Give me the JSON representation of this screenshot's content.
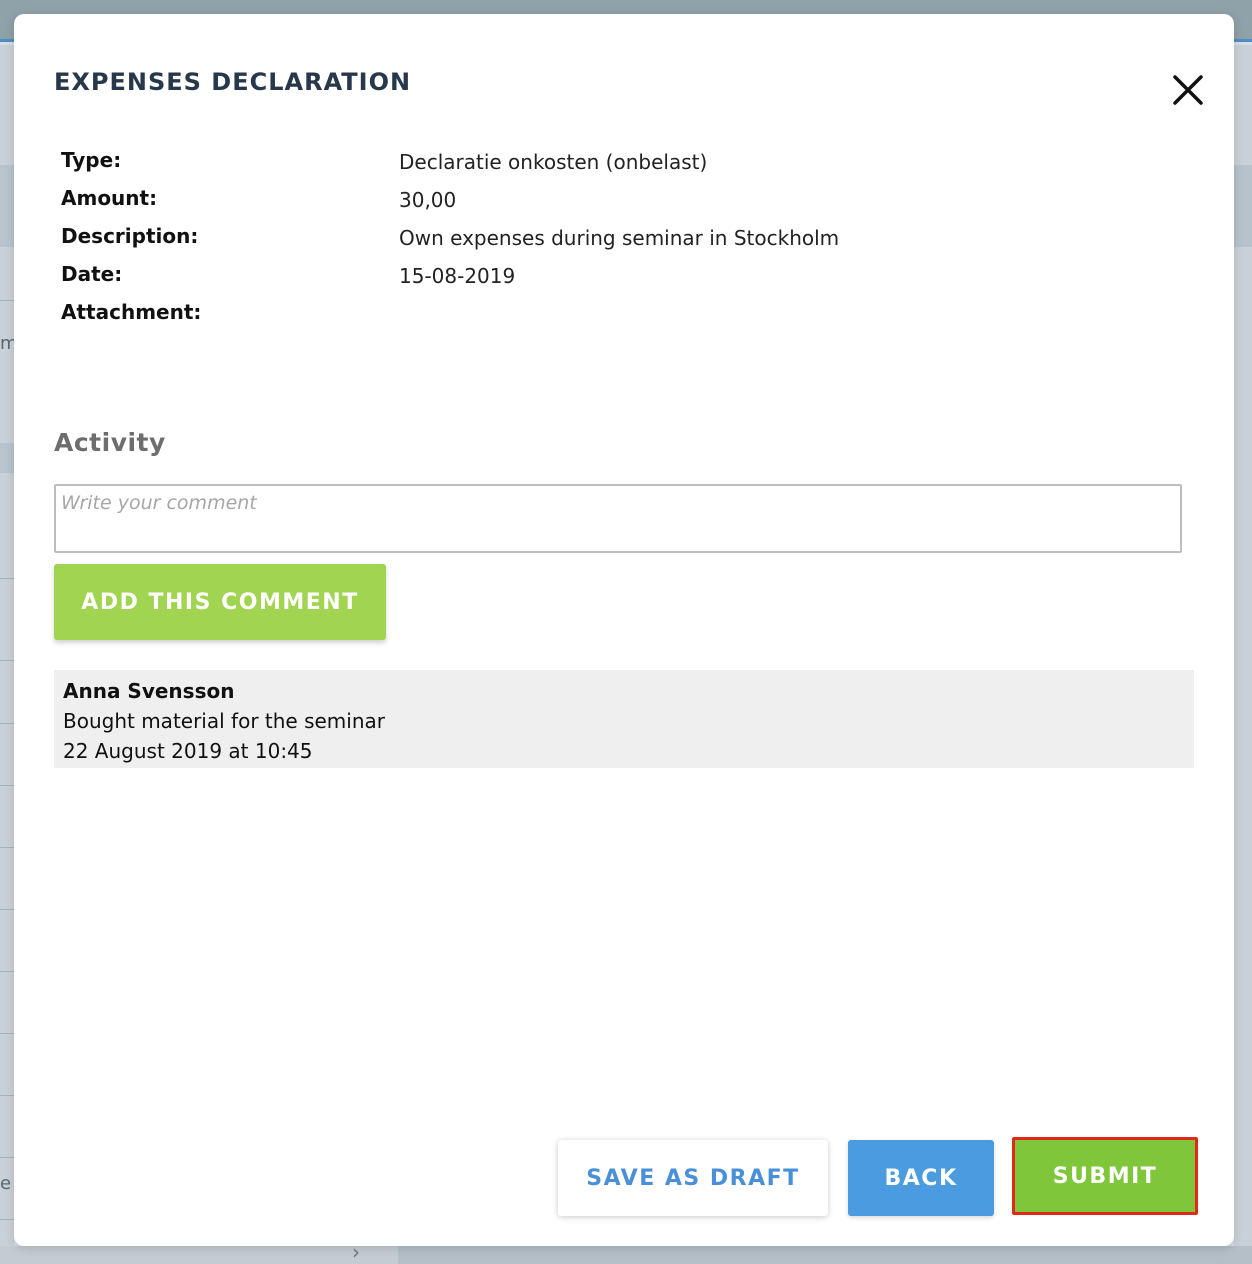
{
  "background": {
    "left_fragments": [
      "m",
      "e"
    ],
    "bottom_chevron": "›"
  },
  "modal": {
    "title": "EXPENSES DECLARATION",
    "close_icon": "close-icon",
    "details": [
      {
        "label": "Type:",
        "value": "Declaratie onkosten (onbelast)"
      },
      {
        "label": "Amount:",
        "value": "30,00"
      },
      {
        "label": "Description:",
        "value": "Own expenses during seminar in Stockholm"
      },
      {
        "label": "Date:",
        "value": "15-08-2019"
      },
      {
        "label": "Attachment:",
        "value": ""
      }
    ],
    "activity": {
      "heading": "Activity",
      "comment_placeholder": "Write your comment",
      "comment_value": "",
      "add_button": "ADD THIS COMMENT",
      "comments": [
        {
          "author": "Anna Svensson",
          "text": "Bought material for the seminar",
          "time": "22 August 2019 at 10:45"
        }
      ]
    },
    "footer": {
      "save_draft": "SAVE AS DRAFT",
      "back": "BACK",
      "submit": "SUBMIT"
    }
  },
  "colors": {
    "title": "#27384a",
    "green_button": "#a0d451",
    "submit_green": "#7fc63a",
    "back_blue": "#4a9be0",
    "draft_text_blue": "#4a90d9",
    "submit_highlight": "#e0291b",
    "comment_bg": "#efefef"
  }
}
